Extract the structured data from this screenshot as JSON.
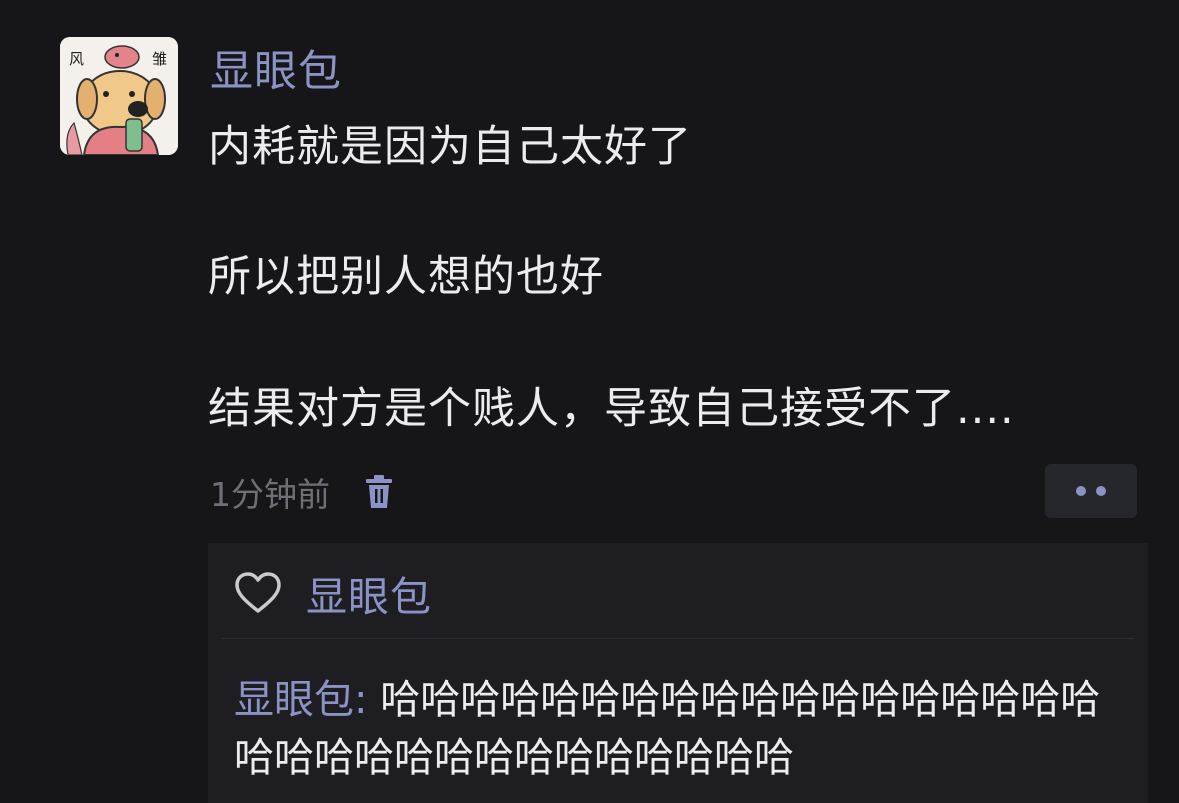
{
  "post": {
    "avatar": {
      "icon": "cartoon-dog-avatar",
      "stamp_left": "风",
      "stamp_right": "雏"
    },
    "username": "显眼包",
    "content_lines": [
      "内耗就是因为自己太好了",
      "所以把别人想的也好",
      "结果对方是个贱人，导致自己接受不了...."
    ],
    "timestamp": "1分钟前",
    "delete_icon": "trash-icon",
    "more_icon": "more-dots-icon"
  },
  "interactions": {
    "like_icon": "heart-icon",
    "liker": "显眼包",
    "comments": [
      {
        "author": "显眼包",
        "separator": ": ",
        "text": "哈哈哈哈哈哈哈哈哈哈哈哈哈哈哈哈哈哈哈哈哈哈哈哈哈哈哈哈哈哈哈哈"
      }
    ]
  },
  "colors": {
    "background": "#161618",
    "accent": "#8a93c4",
    "text": "#ececee",
    "muted": "#6f6f78",
    "panel": "#1e1e22"
  }
}
